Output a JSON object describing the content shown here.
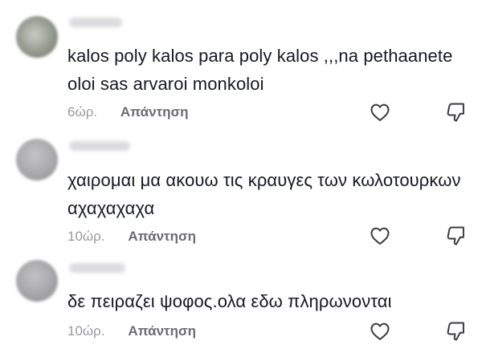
{
  "comments": [
    {
      "text": "kalos poly kalos para poly kalos ,,,na pethaanete oloi sas arvaroi monkoloi",
      "time": "6ώρ.",
      "reply_label": "Απάντηση",
      "avatar_color": "#8a8f86"
    },
    {
      "text": "χαιρομαι μα ακουω τις κραυγες των κωλοτουρκων αχαχαχαχα",
      "time": "10ώρ.",
      "reply_label": "Απάντηση",
      "avatar_color": "#a9a9ab"
    },
    {
      "text": "δε πειραζει ψοφος.ολα εδω πληρωνονται",
      "time": "10ώρ.",
      "reply_label": "Απάντηση",
      "avatar_color": "#a6a6a8"
    }
  ],
  "icons": {
    "like": "heart-icon",
    "dislike": "thumbs-down-icon"
  },
  "colors": {
    "text": "#161823",
    "time": "#9a9aa0",
    "reply": "#6b6b73",
    "icon": "#3a3a42"
  }
}
